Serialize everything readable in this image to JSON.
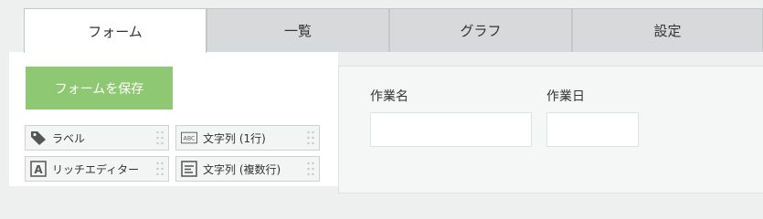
{
  "tabs": [
    {
      "label": "フォーム",
      "active": true
    },
    {
      "label": "一覧",
      "active": false
    },
    {
      "label": "グラフ",
      "active": false
    },
    {
      "label": "設定",
      "active": false
    }
  ],
  "save_button": {
    "label": "フォームを保存",
    "color": "#8fc872"
  },
  "palette": [
    {
      "label": "ラベル",
      "icon": "tag-icon"
    },
    {
      "label": "文字列 (1行)",
      "icon": "text-single-line-icon"
    },
    {
      "label": "リッチエディター",
      "icon": "rich-editor-icon"
    },
    {
      "label": "文字列 (複数行)",
      "icon": "text-multi-line-icon"
    }
  ],
  "form_fields": [
    {
      "label": "作業名",
      "value": ""
    },
    {
      "label": "作業日",
      "value": ""
    }
  ]
}
